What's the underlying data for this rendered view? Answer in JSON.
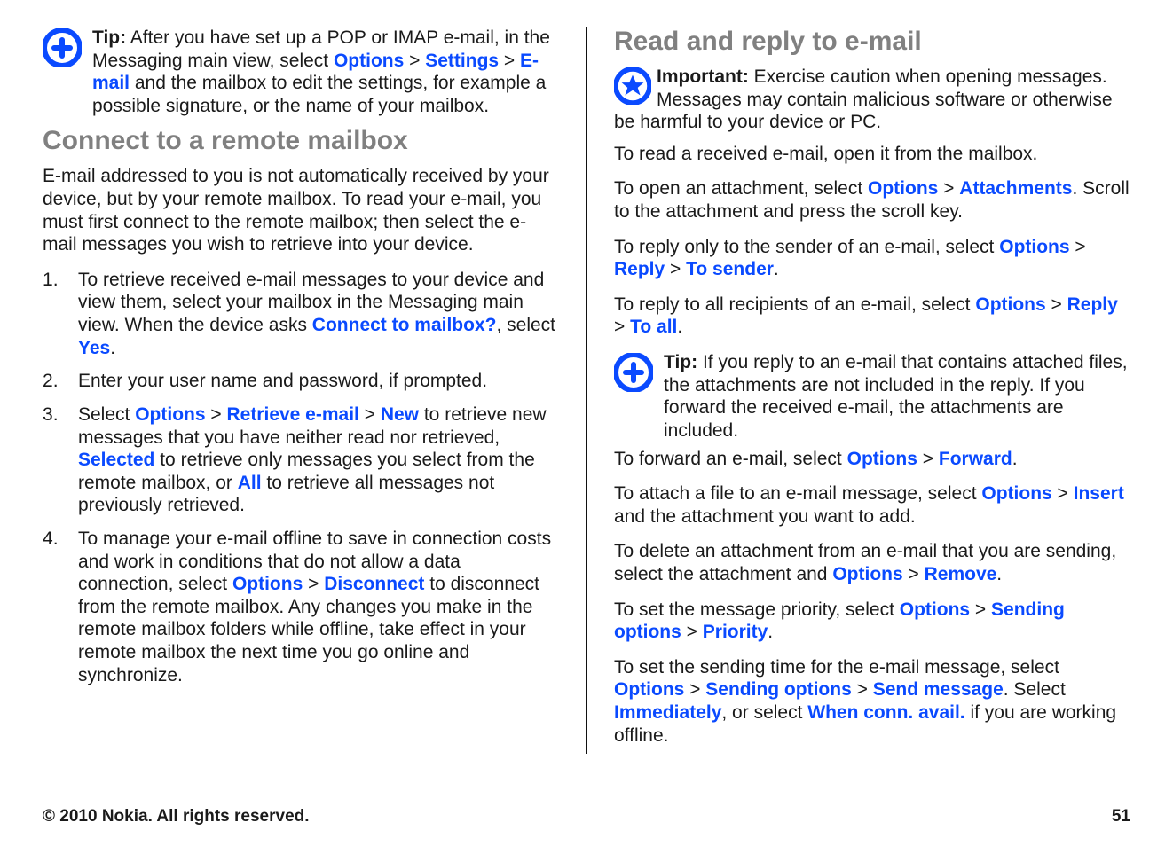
{
  "left": {
    "tip": {
      "label": "Tip:",
      "t1": " After you have set up a POP or IMAP e-mail, in the Messaging main view, select ",
      "opt": "Options",
      "set": "Settings",
      "email": "E-mail",
      "t2": " and the mailbox to edit the settings, for example a possible signature, or the name of your mailbox."
    },
    "h1": "Connect to a remote mailbox",
    "p1": "E-mail addressed to you is not automatically received by your device, but by your remote mailbox. To read your e-mail, you must first connect to the remote mailbox; then select the e-mail messages you wish to retrieve into your device.",
    "li1": {
      "a": "To retrieve received e-mail messages to your device and view them, select your mailbox in the Messaging main view. When the device asks ",
      "b": "Connect to mailbox?",
      "c": ", select ",
      "d": "Yes",
      "e": "."
    },
    "li2": "Enter your user name and password, if prompted.",
    "li3": {
      "a": "Select ",
      "opt": "Options",
      "ret": "Retrieve e-mail",
      "new": "New",
      "b": " to retrieve new messages that you have neither read nor retrieved, ",
      "sel": "Selected",
      "c": " to retrieve only messages you select from the remote mailbox, or ",
      "all": "All",
      "d": " to retrieve all messages not previously retrieved."
    },
    "li4": {
      "a": "To manage your e-mail offline to save in connection costs and work in conditions that do not allow a data connection, select ",
      "opt": "Options",
      "dis": "Disconnect",
      "b": " to disconnect from the remote mailbox. Any changes you make in the remote mailbox folders while offline, take effect in your remote mailbox the next time you go online and synchronize."
    }
  },
  "right": {
    "h1": "Read and reply to e-mail",
    "imp": {
      "label": "Important: ",
      "t": " Exercise caution when opening messages. Messages may contain malicious software or otherwise be harmful to your device or PC."
    },
    "p1": "To read a received e-mail, open it from the mailbox.",
    "att": {
      "a": "To open an attachment, select ",
      "opt": "Options",
      "att": "Attachments",
      "b": ". Scroll to the attachment and press the scroll key."
    },
    "rs": {
      "a": "To reply only to the sender of an e-mail, select ",
      "opt": "Options",
      "rep": "Reply",
      "ts": "To sender",
      "dot": "."
    },
    "ra": {
      "a": "To reply to all recipients of an e-mail, select ",
      "opt": "Options",
      "rep": "Reply",
      "ta": "To all",
      "dot": "."
    },
    "tip": {
      "label": "Tip:",
      "t": " If you reply to an e-mail that contains attached files, the attachments are not included in the reply. If you forward the received e-mail, the attachments are included."
    },
    "fwd": {
      "a": "To forward an e-mail, select ",
      "opt": "Options",
      "f": "Forward",
      "dot": "."
    },
    "ins": {
      "a": "To attach a file to an e-mail message, select ",
      "opt": "Options",
      "i": "Insert",
      "b": " and the attachment you want to add."
    },
    "rem": {
      "a": "To delete an attachment from an e-mail that you are sending, select the attachment and ",
      "opt": "Options",
      "r": "Remove",
      "dot": "."
    },
    "pri": {
      "a": "To set the message priority, select ",
      "opt": "Options",
      "s": "Sending options",
      "p": "Priority",
      "dot": "."
    },
    "send": {
      "a": "To set the sending time for the e-mail message, select ",
      "opt": "Options",
      "so": "Sending options",
      "sm": "Send message",
      "b": ". Select ",
      "imm": "Immediately",
      "c": ", or select ",
      "wca": "When conn. avail.",
      "d": " if you are working offline."
    }
  },
  "footer": {
    "copyright": "© 2010 Nokia. All rights reserved.",
    "page": "51"
  },
  "sep": " > "
}
